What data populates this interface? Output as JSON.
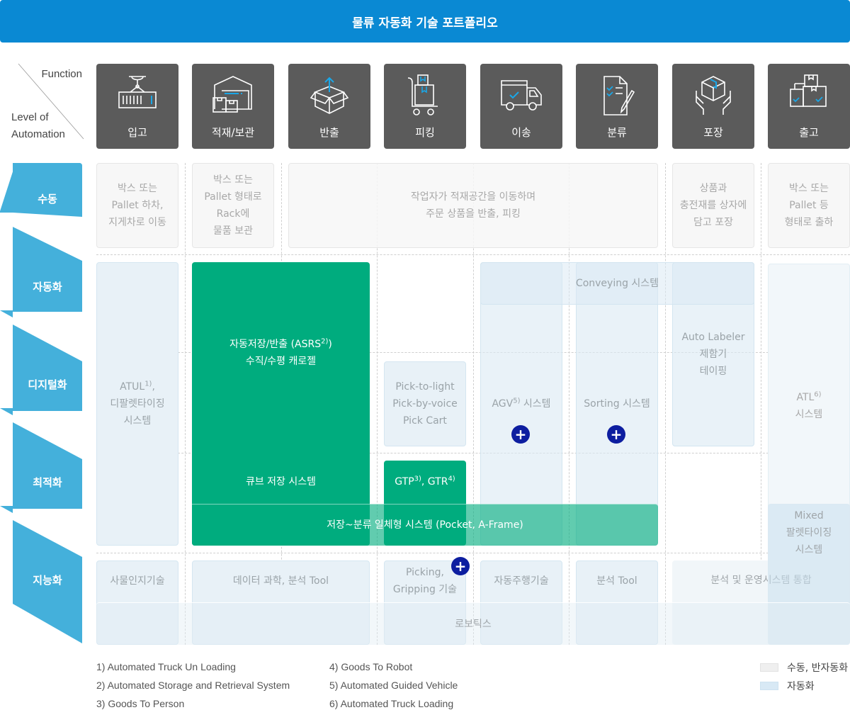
{
  "title": "물류 자동화 기술 포트폴리오",
  "header": {
    "function_label": "Function",
    "level_label_line1": "Level of",
    "level_label_line2": "Automation"
  },
  "functions": [
    {
      "label": "입고",
      "icon": "container-crane-icon"
    },
    {
      "label": "적재/보관",
      "icon": "warehouse-icon"
    },
    {
      "label": "반출",
      "icon": "open-box-icon"
    },
    {
      "label": "피킹",
      "icon": "hand-truck-icon"
    },
    {
      "label": "이송",
      "icon": "truck-icon"
    },
    {
      "label": "분류",
      "icon": "checklist-icon"
    },
    {
      "label": "포장",
      "icon": "box-hands-icon"
    },
    {
      "label": "출고",
      "icon": "stacked-boxes-icon"
    }
  ],
  "levels": [
    "수동",
    "자동화",
    "디지털화",
    "최적화",
    "지능화"
  ],
  "manual_cells": {
    "inbound": [
      "박스 또는",
      "Pallet 하차,",
      "지게차로 이동"
    ],
    "storage": [
      "박스 또는",
      "Pallet 형태로",
      "Rack에",
      "물품 보관"
    ],
    "picking": [
      "작업자가 적재공간을 이동하며",
      "주문 상품을 반출, 피킹"
    ],
    "packing": [
      "상품과",
      "충전재를 상자에",
      "담고 포장"
    ],
    "outbound": [
      "박스 또는",
      "Pallet 등",
      "형태로 출하"
    ]
  },
  "systems": {
    "atul": {
      "name": "ATUL",
      "ref": "1)",
      "suffix": ",",
      "line2": "디팔렛타이징",
      "line3": "시스템"
    },
    "asrs": {
      "line1": "자동저장/반출 (ASRS",
      "ref": "2)",
      "line1_end": ")",
      "line2": "수직/수평 캐로젤"
    },
    "cube": "큐브 저장 시스템",
    "pick_light": [
      "Pick-to-light",
      "Pick-by-voice",
      "Pick Cart"
    ],
    "gtp": {
      "a": "GTP",
      "ref_a": "3)",
      "sep": ", GTR",
      "ref_b": "4)"
    },
    "pocket": "저장~분류 일체형 시스템 (Pocket, A-Frame)",
    "conveying": "Conveying 시스템",
    "agv": {
      "name": "AGV",
      "ref": "5)",
      "suffix": "시스템"
    },
    "sorting": "Sorting 시스템",
    "auto_labeler": [
      "Auto Labeler",
      "제함기",
      "테이핑"
    ],
    "atl": {
      "name": "ATL",
      "ref": "6)",
      "line2": "시스템"
    },
    "mixed": [
      "Mixed",
      "팔렛타이징",
      "시스템"
    ]
  },
  "intelligence": {
    "iot": "사물인지기술",
    "data": "데이터 과학, 분석 Tool",
    "gripping": [
      "Picking,",
      "Gripping 기술"
    ],
    "autonomous": "자동주행기술",
    "analysis": "분석 Tool",
    "integration": "분석 및 운영시스템 통합",
    "robotics": "로보틱스"
  },
  "footnotes": [
    "1) Automated Truck Un Loading",
    "2) Automated Storage and Retrieval System",
    "3) Goods To Person",
    "4) Goods To Robot",
    "5) Automated Guided Vehicle",
    "6) Automated Truck Loading"
  ],
  "legend": [
    {
      "label": "수동, 반자동화",
      "color": "#efefef"
    },
    {
      "label": "자동화",
      "color": "#d8e9f5"
    }
  ],
  "colors": {
    "title": "#0a89d3",
    "function_box": "#5b5b5b",
    "level_band": "#44b0db",
    "green": "#00ac7e",
    "plus": "#0d1ea0",
    "icon_accent": "#1aa7e8"
  }
}
